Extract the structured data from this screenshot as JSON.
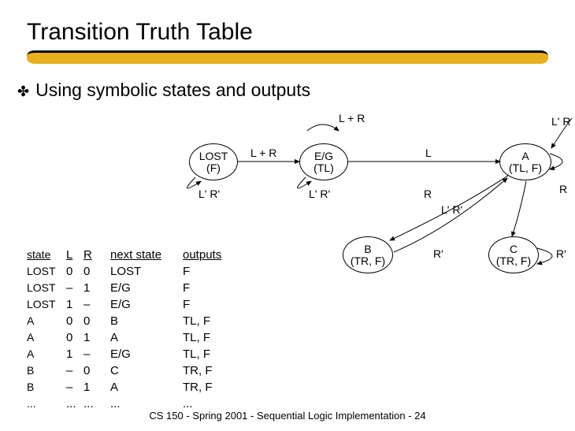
{
  "title": "Transition Truth Table",
  "bullet": "Using symbolic states and outputs",
  "diagram": {
    "states": {
      "lost": {
        "line1": "LOST",
        "line2": "(F)"
      },
      "eg": {
        "line1": "E/G",
        "line2": "(TL)"
      },
      "a": {
        "line1": "A",
        "line2": "(TL, F)"
      },
      "b": {
        "line1": "B",
        "line2": "(TR, F)"
      },
      "c": {
        "line1": "C",
        "line2": "(TR, F)"
      }
    },
    "labels": {
      "top_lr": "L + R",
      "to_eg": "L + R",
      "eg_to_a": "L",
      "a_top": "L' R",
      "lost_self": "L' R'",
      "eg_self": "L' R'",
      "r_to_c": "R",
      "lr_to_b": "L' R'",
      "a_self": "R",
      "b_to_a": "R'",
      "c_self": "R'"
    }
  },
  "table": {
    "headers": {
      "state": "state",
      "L": "L",
      "R": "R",
      "next": "next state",
      "out": "outputs"
    },
    "rows": [
      {
        "state": "LOST",
        "L": "0",
        "R": "0",
        "next": "LOST",
        "out": "F"
      },
      {
        "state": "LOST",
        "L": "–",
        "R": "1",
        "next": "E/G",
        "out": "F"
      },
      {
        "state": "LOST",
        "L": "1",
        "R": "–",
        "next": "E/G",
        "out": "F"
      },
      {
        "state": "A",
        "L": "0",
        "R": "0",
        "next": "B",
        "out": "TL, F"
      },
      {
        "state": "A",
        "L": "0",
        "R": "1",
        "next": "A",
        "out": "TL, F"
      },
      {
        "state": "A",
        "L": "1",
        "R": "–",
        "next": "E/G",
        "out": "TL, F"
      },
      {
        "state": "B",
        "L": "–",
        "R": "0",
        "next": "C",
        "out": "TR, F"
      },
      {
        "state": "B",
        "L": "–",
        "R": "1",
        "next": "A",
        "out": "TR, F"
      },
      {
        "state": "...",
        "L": "...",
        "R": "...",
        "next": "...",
        "out": "..."
      }
    ]
  },
  "footer": "CS 150 - Spring 2001 - Sequential Logic Implementation - 24"
}
